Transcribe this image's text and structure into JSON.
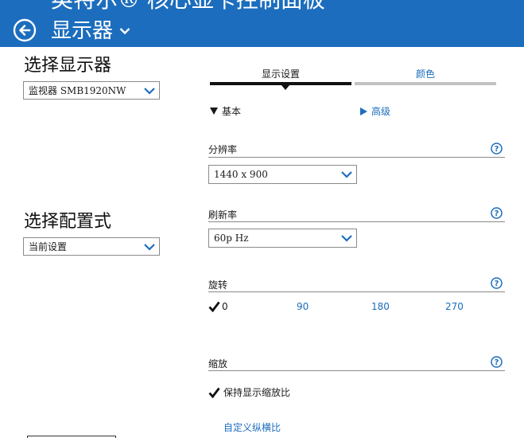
{
  "header": {
    "app_title": "英特尔® 核心显卡控制面板",
    "page_title": "显示器",
    "back_icon": "back-arrow-circle-icon",
    "page_title_icon": "chevron-down-icon",
    "background_color": "#1c6dbd"
  },
  "left": {
    "select_display_heading": "选择显示器",
    "display_select_value": "监视器 SMB1920NW",
    "select_profile_heading": "选择配置式",
    "profile_select_value": "当前设置"
  },
  "tabs": [
    {
      "label": "显示设置",
      "active": true
    },
    {
      "label": "颜色",
      "active": false
    }
  ],
  "modes": {
    "basic": "基本",
    "advanced": "高级"
  },
  "resolution": {
    "label": "分辨率",
    "value": "1440 x 900"
  },
  "refresh_rate": {
    "label": "刷新率",
    "value": "60p Hz"
  },
  "rotation": {
    "label": "旋转",
    "options": [
      "0",
      "90",
      "180",
      "270"
    ],
    "selected": "0"
  },
  "scaling": {
    "label": "缩放",
    "keep_ratio_label": "保持显示缩放比",
    "custom_ratio_link": "自定义纵横比"
  },
  "colors": {
    "accent": "#1c6dbd",
    "text": "#1a1a1a",
    "inactive_tab_bar": "#c2c2c2"
  }
}
